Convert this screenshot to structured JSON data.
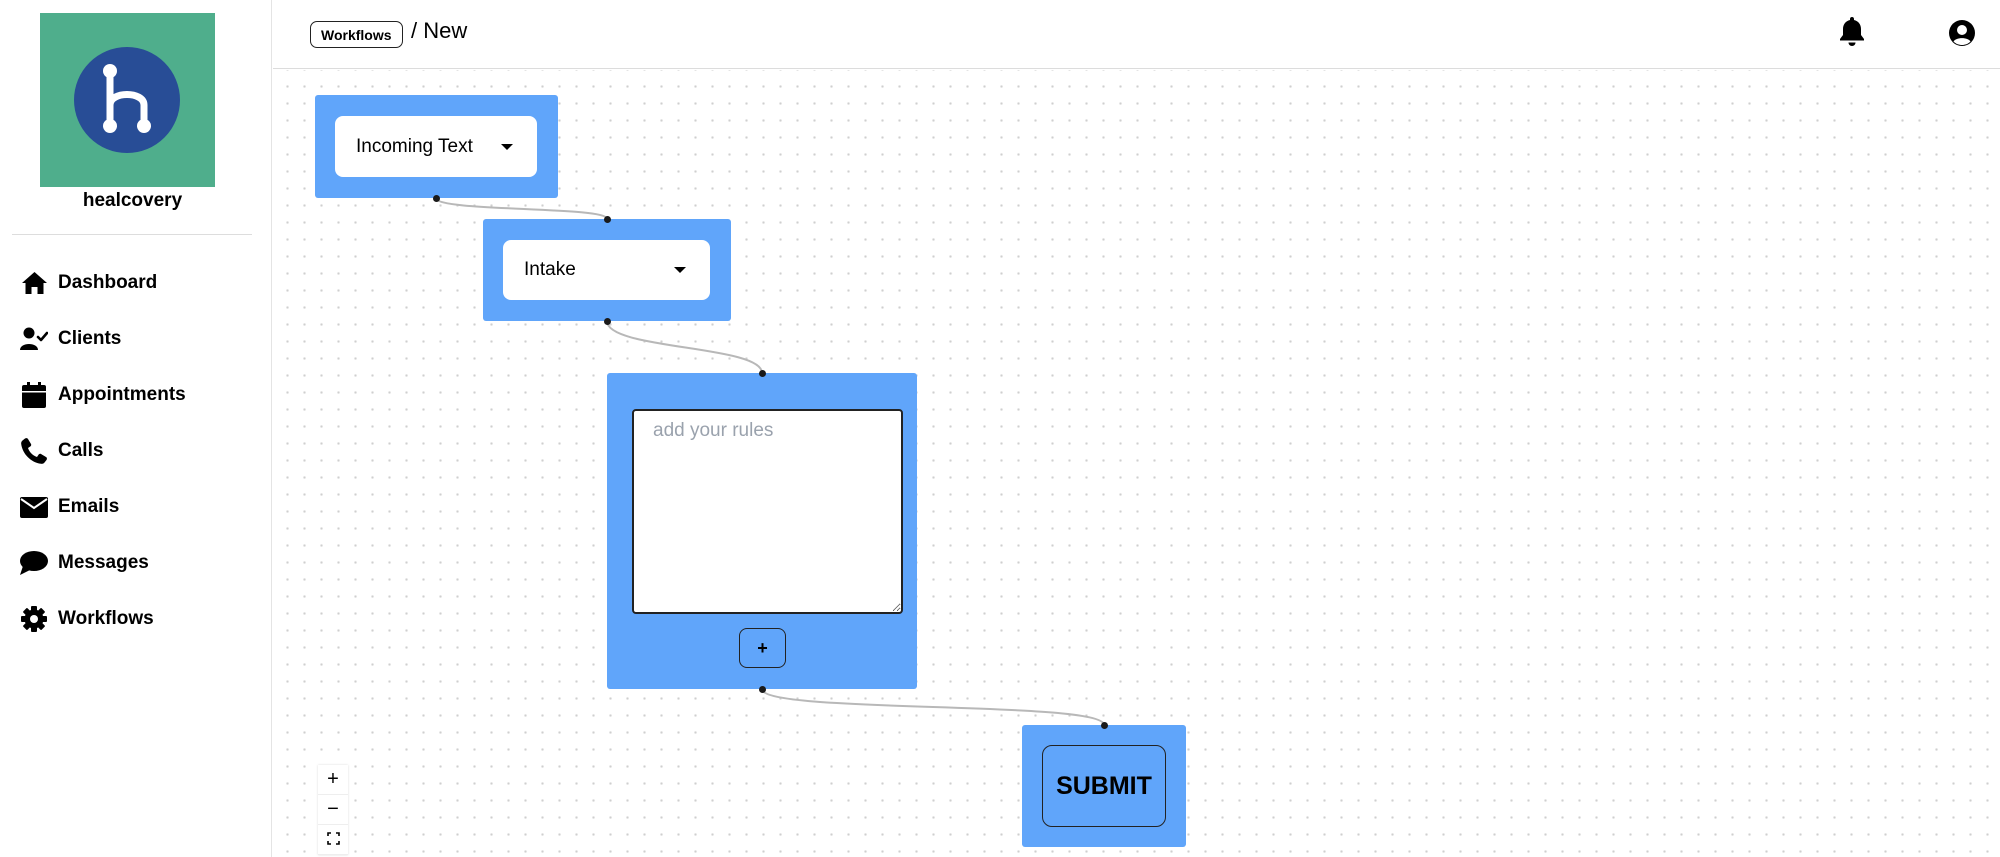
{
  "brand": {
    "name": "healcovery",
    "logo_bg": "#4fae8c",
    "logo_circle": "#284d96"
  },
  "nav": {
    "items": [
      {
        "label": "Dashboard",
        "icon": "house-icon"
      },
      {
        "label": "Clients",
        "icon": "user-check-icon"
      },
      {
        "label": "Appointments",
        "icon": "calendar-icon"
      },
      {
        "label": "Calls",
        "icon": "phone-icon"
      },
      {
        "label": "Emails",
        "icon": "envelope-icon"
      },
      {
        "label": "Messages",
        "icon": "chat-bubble-icon"
      },
      {
        "label": "Workflows",
        "icon": "gear-icon"
      }
    ]
  },
  "header": {
    "breadcrumb_root": "Workflows",
    "breadcrumb_current": "/ New",
    "icons": [
      "bell-icon",
      "account-circle-icon"
    ]
  },
  "workflow": {
    "node_color": "#60a5fa",
    "trigger_select": {
      "value": "Incoming Text"
    },
    "stage_select": {
      "value": "Intake"
    },
    "rules": {
      "placeholder": "add your rules",
      "value": ""
    },
    "add_rule_label": "+",
    "submit_label": "SUBMIT"
  },
  "canvas_controls": {
    "zoom_in": "+",
    "zoom_out": "−",
    "fit_view_icon": "fit-view-icon"
  }
}
